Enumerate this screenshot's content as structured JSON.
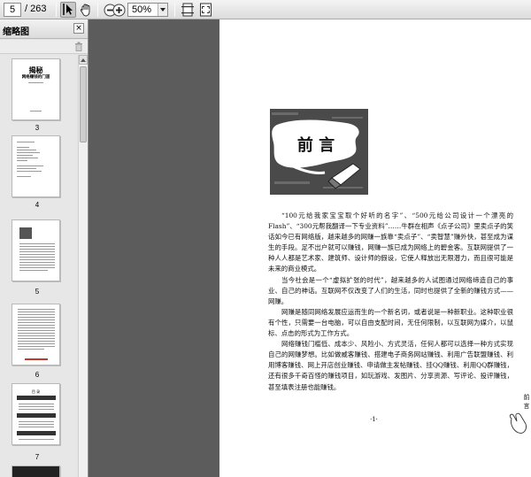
{
  "toolbar": {
    "current_page": "5",
    "total_pages": "/ 263",
    "zoom_value": "50%"
  },
  "panel": {
    "title": "缩略图",
    "close_glyph": "×",
    "thumbnails": [
      {
        "page": "3",
        "title": "揭秘",
        "subtitle": "网络赚钱的门道"
      },
      {
        "page": "4"
      },
      {
        "page": "5"
      },
      {
        "page": "6"
      },
      {
        "page": "7",
        "heading": "目 录"
      }
    ]
  },
  "page": {
    "heading": "前 言",
    "side_label": "前言",
    "page_number": "·1·",
    "paragraphs": [
      "“100元给我家宝宝取个好听的名字”、“500元给公司设计一个漂亮的Flash”、“300元帮我翻译一下专业资料”……牛群在相声《点子公司》里卖点子的笑话如今已有网络版，越来越多的网赚一族靠“卖点子”、“卖智慧”赚外快，甚至成为谋生的手段。足不出户就可以赚钱，网赚一族已成为网络上的碧金客。互联网提供了一种人人都是艺术家、建筑师、设计师的假设，它使人释放出无限潜力，而且很可能是未来的商业模式。",
      "当今社会是一个“虚拟扩张的时代”，越来越多的人试图通过网络缔造自己的事业、自己的神话。互联网不仅改变了人们的生活，同时也提供了全新的赚钱方式——网赚。",
      "网赚是随同网络发展应运而生的一个新名词，或者说是一种新职业。这种职业很有个性，只需要一台电脑，可以自由支配时间，无任何限制，以互联网为媒介，以鼠标、点击的形式为工作方式。",
      "网络赚钱门槛低、成本少、风险小、方式灵活，任何人都可以选择一种方式实现自己的网赚梦想。比如做威客赚钱、搭建电子商务网站赚钱、利用广告联盟赚钱、利用博客赚钱、网上开店创业赚钱、申请做主发帖赚钱、挂QQ赚钱、利用QQ群赚钱，还有很多千奇百怪的赚钱项目，如玩游戏、发图片、分享资源、写评论、投评赚钱，甚至填表注册也能赚钱。"
    ]
  },
  "colors": {
    "workspace": "#5c5c5c",
    "panel": "#e5e5e5",
    "toolbar": "#e4e4e4"
  }
}
